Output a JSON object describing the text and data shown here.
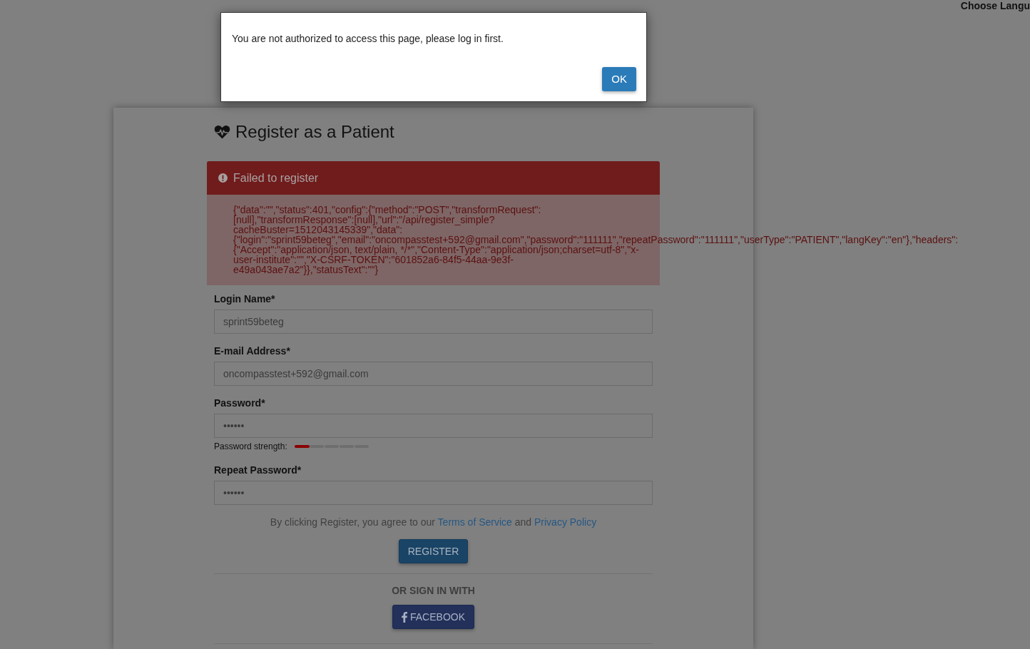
{
  "language_menu": {
    "label": "Choose Langu"
  },
  "form": {
    "title": "Register as a Patient",
    "alert": {
      "title": "Failed to register",
      "message": "{\"data\":\"\",\"status\":401,\"config\":{\"method\":\"POST\",\"transformRequest\":[null],\"transformResponse\":[null],\"url\":\"/api/register_simple?cacheBuster=1512043145339\",\"data\":{\"login\":\"sprint59beteg\",\"email\":\"oncompasstest+592@gmail.com\",\"password\":\"111111\",\"repeatPassword\":\"111111\",\"userType\":\"PATIENT\",\"langKey\":\"en\"},\"headers\":{\"Accept\":\"application/json, text/plain, */*\",\"Content-Type\":\"application/json;charset=utf-8\",\"x-user-institute\":\"\",\"X-CSRF-TOKEN\":\"601852a6-84f5-44aa-9e3f-e49a043ae7a2\"}},\"statusText\":\"\"}"
    },
    "fields": [
      {
        "kind": "text",
        "label": "Login Name*",
        "value": "sprint59beteg"
      },
      {
        "kind": "text",
        "label": "E-mail Address*",
        "value": "oncompasstest+592@gmail.com"
      },
      {
        "kind": "password",
        "label": "Password*",
        "value": "••••••",
        "strength": {
          "label": "Password strength:",
          "level": 0.2
        }
      },
      {
        "kind": "password",
        "label": "Repeat Password*",
        "value": "••••••"
      }
    ],
    "terms": [
      {
        "kind": "text",
        "text": "By clicking Register, you agree to our"
      },
      {
        "kind": "link",
        "text": "Terms of Service"
      },
      {
        "kind": "text",
        "text": "and"
      },
      {
        "kind": "link",
        "text": "Privacy Policy"
      }
    ],
    "register_button": "REGISTER",
    "social": {
      "heading": "OR SIGN IN WITH",
      "buttons": [
        {
          "label": "FACEBOOK"
        }
      ]
    }
  },
  "dialog": {
    "message": "You are not authorized to access this page, please log in first.",
    "buttons": [
      "OK"
    ]
  }
}
